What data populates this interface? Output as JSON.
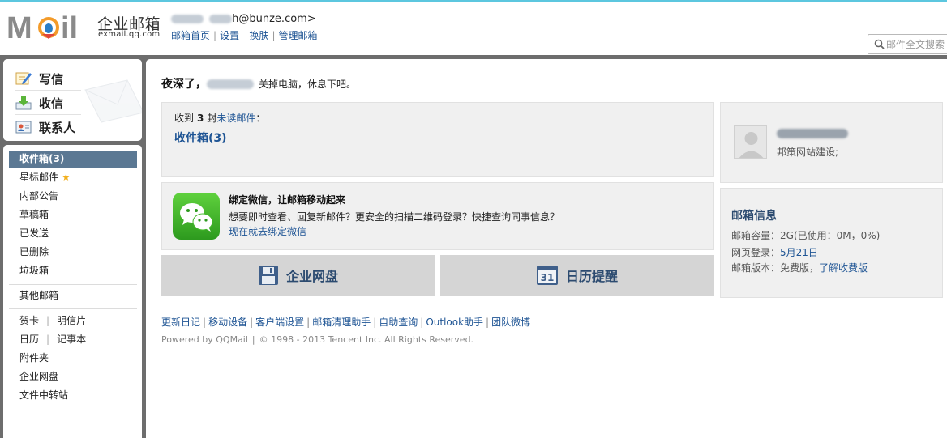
{
  "header": {
    "brand_name": "企业邮箱",
    "brand_domain": "exmail.qq.com",
    "logo_text": "MOil",
    "account_suffix": "h@bunze.com>",
    "links": {
      "home": "邮箱首页",
      "settings": "设置",
      "skin": "换肤",
      "admin": "管理邮箱"
    },
    "search_placeholder": "邮件全文搜索"
  },
  "sidebar": {
    "quick": {
      "compose": "写信",
      "receive": "收信",
      "contacts": "联系人"
    },
    "folders": {
      "inbox": "收件箱(3)",
      "starred": "星标邮件",
      "notice": "内部公告",
      "drafts": "草稿箱",
      "sent": "已发送",
      "deleted": "已删除",
      "spam": "垃圾箱"
    },
    "other_mail": "其他邮箱",
    "tools": {
      "greeting_card": "贺卡",
      "postcard": "明信片",
      "calendar": "日历",
      "notes": "记事本",
      "attachments": "附件夹",
      "netdisk": "企业网盘",
      "transfer": "文件中转站"
    }
  },
  "main": {
    "greeting": {
      "prefix": "夜深了，",
      "tip": "关掉电脑，休息下吧。"
    },
    "unread": {
      "received_prefix": "收到",
      "count": "3",
      "unit": "封",
      "unread_link": "未读邮件",
      "colon": "：",
      "inbox_link": "收件箱(3)"
    },
    "wechat": {
      "title": "绑定微信，让邮箱移动起来",
      "desc": "想要即时查看、回复新邮件？更安全的扫描二维码登录？快捷查询同事信息？",
      "link": "现在就去绑定微信"
    },
    "buttons": {
      "netdisk": "企业网盘",
      "calendar": "日历提醒",
      "calendar_day": "31"
    },
    "footer": {
      "links": [
        "更新日记",
        "移动设备",
        "客户端设置",
        "邮箱清理助手",
        "自助查询",
        "Outlook助手",
        "团队微博"
      ],
      "powered": "Powered by QQMail",
      "copyright": "© 1998 - 2013 Tencent Inc. All Rights Reserved."
    },
    "profile": {
      "signature": "邦策网站建设;"
    },
    "mailbox_info": {
      "title": "邮箱信息",
      "capacity_label": "邮箱容量：",
      "capacity_value": "2G(已使用：0M，0%)",
      "last_login_label": "网页登录：",
      "last_login_value": "5月21日",
      "version_label": "邮箱版本：",
      "version_value": "免费版，",
      "version_link": "了解收费版"
    }
  },
  "colors": {
    "accent_line": "#5cc7df",
    "frame": "#6d6d6d",
    "active_folder": "#5b7893",
    "link": "#1e5494",
    "panel": "#f0f0f0",
    "big_button": "#d5d5d5"
  }
}
